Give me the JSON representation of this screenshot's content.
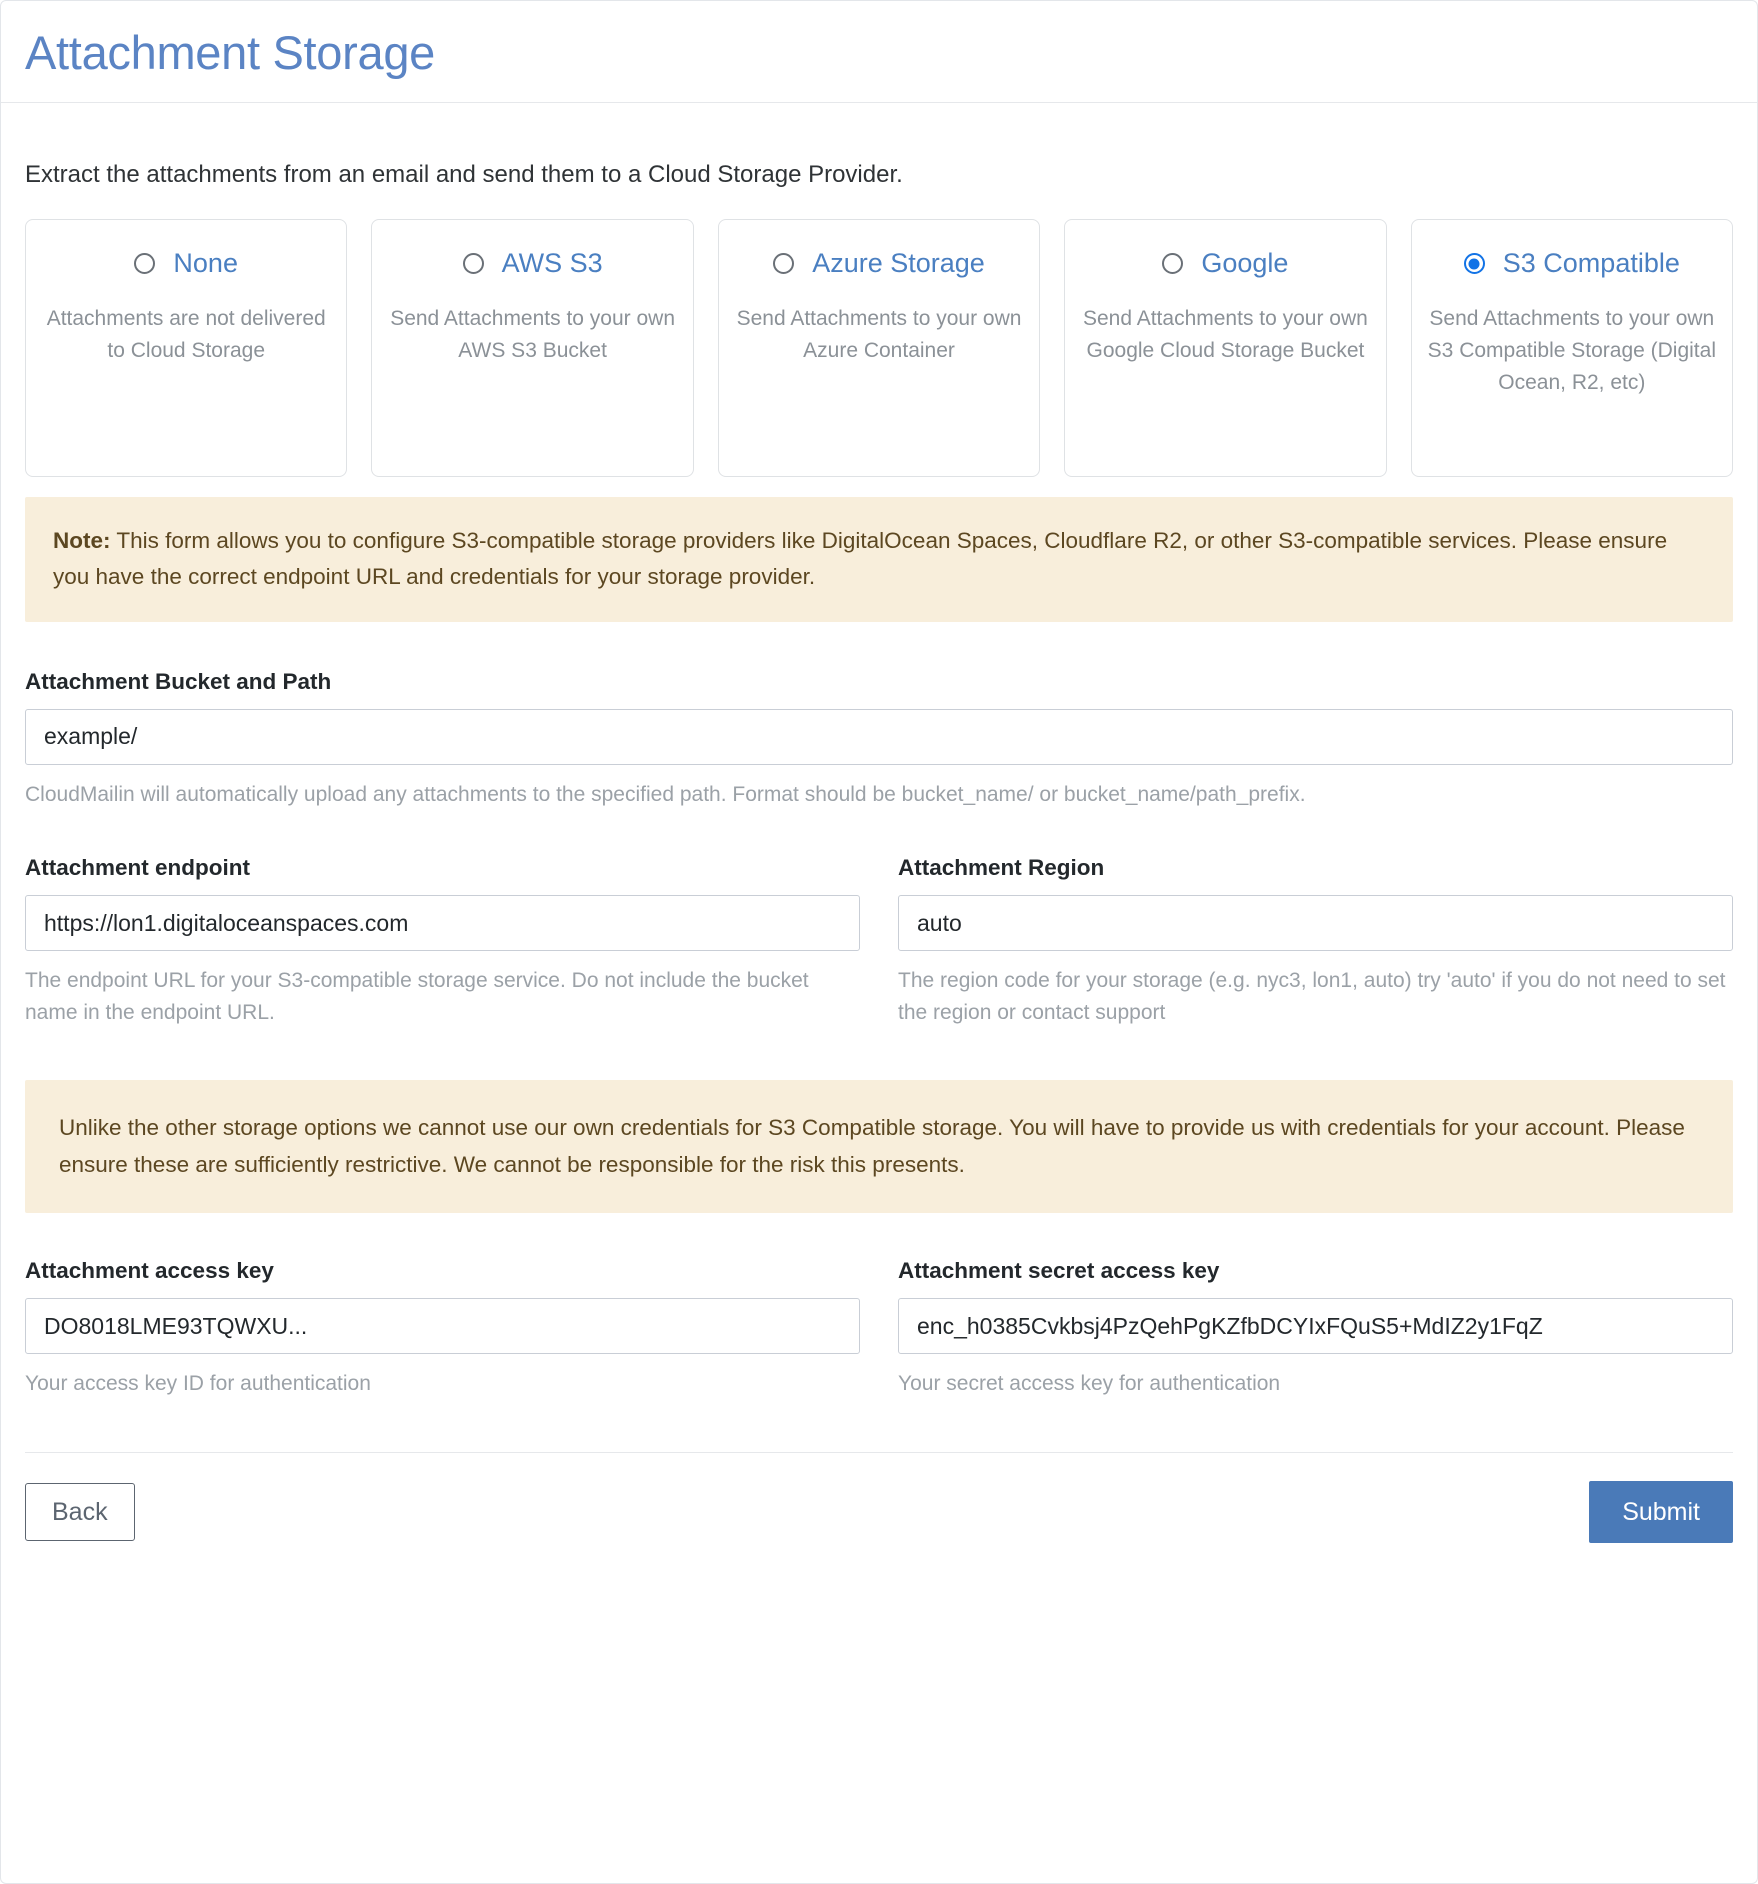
{
  "page": {
    "title": "Attachment Storage",
    "intro": "Extract the attachments from an email and send them to a Cloud Storage Provider."
  },
  "colors": {
    "title": "#5b84c4",
    "option_label": "#4a7fc1",
    "radio_selected": "#1273e6",
    "alert_bg": "#f8eedb",
    "alert_text": "#5c4721",
    "submit_bg": "#4a7ab8"
  },
  "storage_options": [
    {
      "id": "none",
      "label": "None",
      "description": "Attachments are not delivered to Cloud Storage",
      "selected": false
    },
    {
      "id": "aws-s3",
      "label": "AWS S3",
      "description": "Send Attachments to your own AWS S3 Bucket",
      "selected": false
    },
    {
      "id": "azure-storage",
      "label": "Azure Storage",
      "description": "Send Attachments to your own Azure Container",
      "selected": false
    },
    {
      "id": "google",
      "label": "Google",
      "description": "Send Attachments to your own Google Cloud Storage Bucket",
      "selected": false
    },
    {
      "id": "s3-compatible",
      "label": "S3 Compatible",
      "description": "Send Attachments to your own S3 Compatible Storage (Digital Ocean, R2, etc)",
      "selected": true
    }
  ],
  "alerts": {
    "note_prefix": "Note:",
    "note_body": " This form allows you to configure S3-compatible storage providers like DigitalOcean Spaces, Cloudflare R2, or other S3-compatible services. Please ensure you have the correct endpoint URL and credentials for your storage provider.",
    "credentials_warning": "Unlike the other storage options we cannot use our own credentials for S3 Compatible storage. You will have to provide us with credentials for your account. Please ensure these are sufficiently restrictive. We cannot be responsible for the risk this presents."
  },
  "fields": {
    "bucket_path": {
      "label": "Attachment Bucket and Path",
      "value": "example/",
      "placeholder": "",
      "hint": "CloudMailin will automatically upload any attachments to the specified path. Format should be bucket_name/ or bucket_name/path_prefix."
    },
    "endpoint": {
      "label": "Attachment endpoint",
      "value": "https://lon1.digitaloceanspaces.com",
      "placeholder": "",
      "hint": "The endpoint URL for your S3-compatible storage service. Do not include the bucket name in the endpoint URL."
    },
    "region": {
      "label": "Attachment Region",
      "value": "auto",
      "placeholder": "",
      "hint": "The region code for your storage (e.g. nyc3, lon1, auto) try 'auto' if you do not need to set the region or contact support"
    },
    "access_key": {
      "label": "Attachment access key",
      "value": "DO8018LME93TQWXU...",
      "placeholder": "",
      "hint": "Your access key ID for authentication"
    },
    "secret_access_key": {
      "label": "Attachment secret access key",
      "value": "enc_h0385Cvkbsj4PzQehPgKZfbDCYIxFQuS5+MdIZ2y1FqZ",
      "placeholder": "",
      "hint": "Your secret access key for authentication"
    }
  },
  "footer": {
    "back_label": "Back",
    "submit_label": "Submit"
  }
}
